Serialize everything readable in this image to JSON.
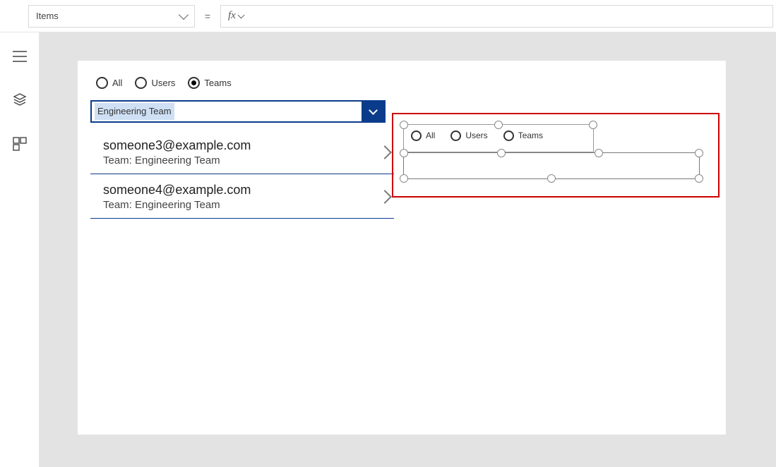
{
  "topbar": {
    "property": "Items",
    "equals": "=",
    "fx": "fx"
  },
  "leftPanel": {
    "radios": {
      "all": "All",
      "users": "Users",
      "teams": "Teams"
    },
    "dropdown": {
      "value": "Engineering Team"
    },
    "list": [
      {
        "primary": "someone3@example.com",
        "secondary": "Team: Engineering Team"
      },
      {
        "primary": "someone4@example.com",
        "secondary": "Team: Engineering Team"
      }
    ]
  },
  "rightDesign": {
    "radios": {
      "all": "All",
      "users": "Users",
      "teams": "Teams"
    }
  }
}
